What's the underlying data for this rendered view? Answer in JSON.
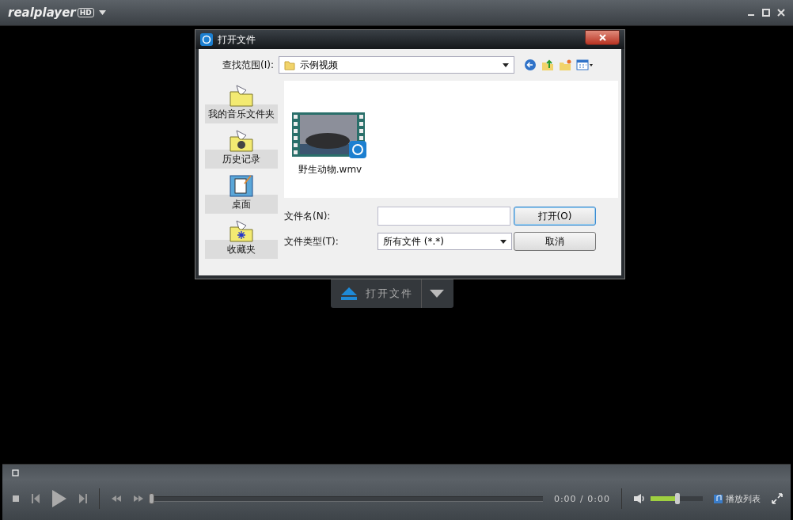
{
  "app": {
    "logo": "realplayer",
    "logo_badge": "HD"
  },
  "dialog": {
    "title": "打开文件",
    "look_in_label": "查找范围(I):",
    "look_in_value": "示例视频",
    "places": [
      {
        "label": "我的音乐文件夹",
        "kind": "music"
      },
      {
        "label": "历史记录",
        "kind": "history"
      },
      {
        "label": "桌面",
        "kind": "desktop"
      },
      {
        "label": "收藏夹",
        "kind": "favorites"
      }
    ],
    "files": [
      {
        "name": "野生动物.wmv"
      }
    ],
    "filename_label": "文件名(N):",
    "filetype_label": "文件类型(T):",
    "filetype_value": "所有文件 (*.*)",
    "open_button": "打开(O)",
    "cancel_button": "取消"
  },
  "open_file_button": "打开文件",
  "player": {
    "seek": {
      "level": 0
    },
    "time": "0:00 / 0:00",
    "volume": {
      "level": 0.52
    },
    "playlist_button": "播放列表"
  }
}
